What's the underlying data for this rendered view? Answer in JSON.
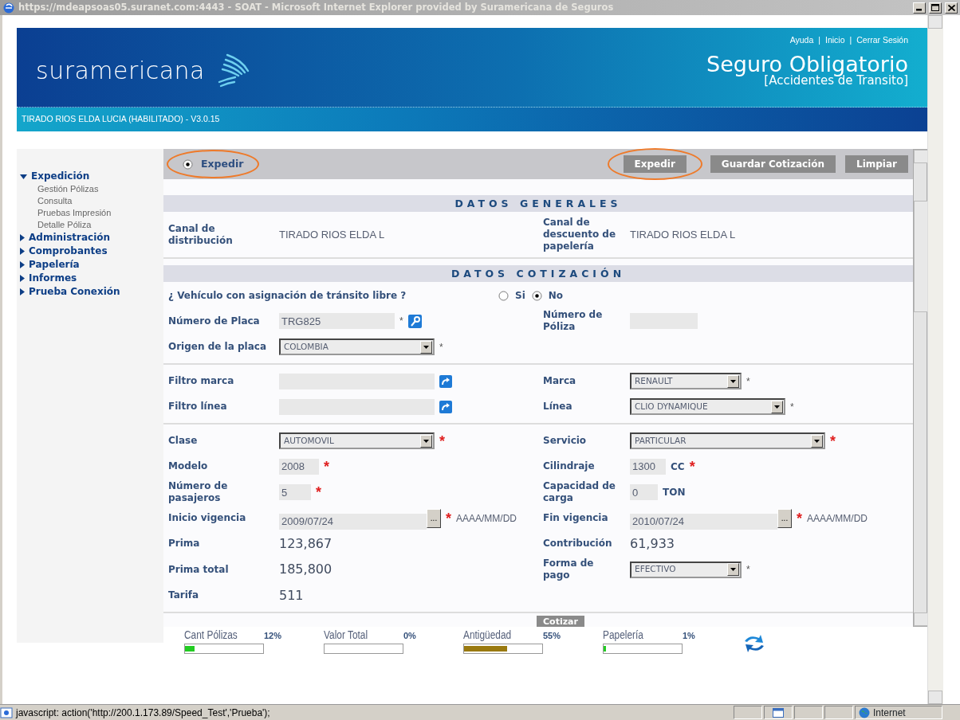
{
  "window": {
    "title": "https://mdeapsoas05.suranet.com:4443 - SOAT - Microsoft Internet Explorer provided by Suramericana de Seguros"
  },
  "header": {
    "logo": "suramericana",
    "links": [
      {
        "kind": "link",
        "label": "Ayuda"
      },
      {
        "kind": "separator",
        "label": "|"
      },
      {
        "kind": "link",
        "label": "Inicio"
      },
      {
        "kind": "separator",
        "label": "|"
      },
      {
        "kind": "link",
        "label": "Cerrar Sesión"
      }
    ],
    "title": "Seguro Obligatorio",
    "subtitle": "[Accidentes de Transito]",
    "user": "TIRADO RIOS ELDA LUCIA (HABILITADO) - V3.0.15"
  },
  "sidebar": {
    "items": [
      {
        "label": "Expedición",
        "expanded": true,
        "children": [
          {
            "label": "Gestión Pólizas"
          },
          {
            "label": "Consulta"
          },
          {
            "label": "Pruebas Impresión"
          },
          {
            "label": "Detalle Póliza"
          }
        ]
      },
      {
        "label": "Administración",
        "expanded": false
      },
      {
        "label": "Comprobantes",
        "expanded": false
      },
      {
        "label": "Papelería",
        "expanded": false
      },
      {
        "label": "Informes",
        "expanded": false
      },
      {
        "label": "Prueba Conexión",
        "expanded": false
      }
    ]
  },
  "toolbar": {
    "mode": {
      "label": "Expedir",
      "selected": true,
      "highlighted": true
    },
    "buttons": [
      {
        "label": "Expedir",
        "highlighted": true
      },
      {
        "label": "Guardar Cotización",
        "highlighted": false
      },
      {
        "label": "Limpiar",
        "highlighted": false
      }
    ]
  },
  "sections": [
    {
      "title": "DATOS GENERALES",
      "groups": [
        [
          {
            "kind": "fields",
            "cells": [
              {
                "label": "Canal de distribución",
                "kind": "text",
                "value": "TIRADO RIOS ELDA L"
              },
              {
                "label": "Canal de descuento de papelería",
                "kind": "text",
                "value": "TIRADO RIOS ELDA L"
              }
            ]
          }
        ]
      ]
    },
    {
      "title": "DATOS COTIZACIÓN",
      "groups": [
        [
          {
            "kind": "question",
            "label": "¿ Vehículo con asignación de tránsito libre ?",
            "options": [
              {
                "label": "Si",
                "selected": false
              },
              {
                "label": "No",
                "selected": true
              }
            ]
          },
          {
            "kind": "fields",
            "cells": [
              {
                "label": "Número de Placa",
                "kind": "lookup",
                "value": "TRG825",
                "required": "*",
                "emphasized": false
              },
              {
                "label": "Número de Póliza",
                "kind": "input"
              }
            ]
          },
          {
            "kind": "fields",
            "cells": [
              {
                "label": "Origen de la placa",
                "kind": "select",
                "value": "COLOMBIA",
                "required": "*",
                "emphasized": false
              }
            ]
          }
        ],
        [
          {
            "kind": "fields",
            "cells": [
              {
                "label": "Filtro marca",
                "kind": "filter"
              },
              {
                "label": "Marca",
                "kind": "select",
                "value": "RENAULT",
                "required": "*",
                "emphasized": false
              }
            ]
          },
          {
            "kind": "fields",
            "cells": [
              {
                "label": "Filtro línea",
                "kind": "filter"
              },
              {
                "label": "Línea",
                "kind": "select",
                "value": "CLIO DYNAMIQUE",
                "required": "*",
                "emphasized": false
              }
            ]
          }
        ],
        [
          {
            "kind": "fields",
            "cells": [
              {
                "label": "Clase",
                "kind": "select",
                "value": "AUTOMOVIL",
                "required": "*",
                "emphasized": true
              },
              {
                "label": "Servicio",
                "kind": "select",
                "value": "PARTICULAR",
                "required": "*",
                "emphasized": true
              }
            ]
          },
          {
            "kind": "fields",
            "cells": [
              {
                "label": "Modelo",
                "kind": "input",
                "value": "2008",
                "required": "*",
                "emphasized": true
              },
              {
                "label": "Cilindraje",
                "kind": "input",
                "value": "1300",
                "unit": "CC",
                "required": "*",
                "emphasized": true
              }
            ]
          },
          {
            "kind": "fields",
            "cells": [
              {
                "label": "Número de pasajeros",
                "kind": "input",
                "value": "5",
                "required": "*",
                "emphasized": true
              },
              {
                "label": "Capacidad de carga",
                "kind": "input",
                "value": "0",
                "unit": "TON"
              }
            ]
          },
          {
            "kind": "fields",
            "cells": [
              {
                "label": "Inicio vigencia",
                "kind": "date",
                "value": "2009/07/24",
                "picker": "...",
                "required": "*",
                "emphasized": true,
                "format": "AAAA/MM/DD"
              },
              {
                "label": "Fin vigencia",
                "kind": "date",
                "value": "2010/07/24",
                "picker": "...",
                "required": "*",
                "emphasized": true,
                "format": "AAAA/MM/DD"
              }
            ]
          },
          {
            "kind": "fields",
            "cells": [
              {
                "label": "Prima",
                "kind": "amount",
                "value": "123,867"
              },
              {
                "label": "Contribución",
                "kind": "amount",
                "value": "61,933"
              }
            ]
          },
          {
            "kind": "fields",
            "cells": [
              {
                "label": "Prima total",
                "kind": "amount",
                "value": "185,800"
              },
              {
                "label": "Forma de pago",
                "kind": "select",
                "value": "EFECTIVO",
                "required": "*",
                "emphasized": false
              }
            ]
          },
          {
            "kind": "fields",
            "cells": [
              {
                "label": "Tarifa",
                "kind": "amount",
                "value": "511"
              }
            ]
          }
        ]
      ]
    }
  ],
  "quote_button": "Cotizar",
  "meters": [
    {
      "label": "Cant Pólizas",
      "reading": "12%",
      "level": 0.12,
      "color": "#22cc22"
    },
    {
      "label": "Valor Total",
      "reading": "0%",
      "level": 0
    },
    {
      "label": "Antigüedad",
      "reading": "55%",
      "level": 0.55,
      "color": "#9a7a10"
    },
    {
      "label": "Papelería",
      "reading": "1%",
      "level": 0.01,
      "color": "#22cc22"
    }
  ],
  "status_bar": {
    "text": "javascript: action('http://200.1.173.89/Speed_Test','Prueba');",
    "zone": "Internet"
  }
}
